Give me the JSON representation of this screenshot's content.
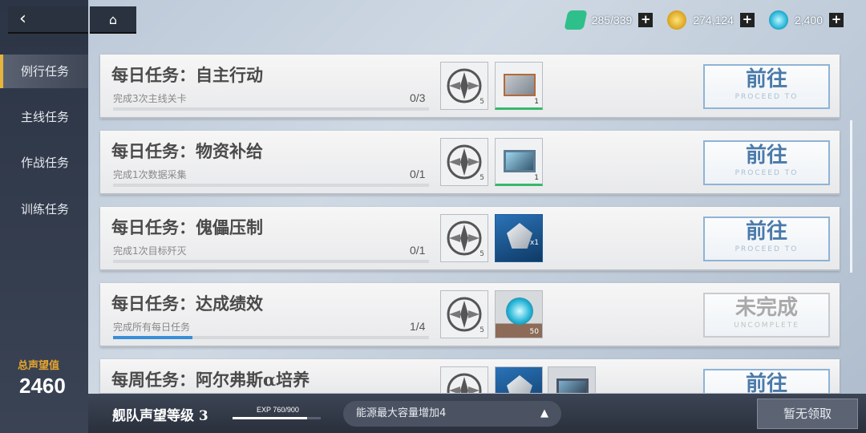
{
  "nav": {
    "back_icon": "‹",
    "home_icon": "⌂"
  },
  "sidebar": {
    "items": [
      {
        "label": "例行任务",
        "active": true
      },
      {
        "label": "主线任务",
        "active": false
      },
      {
        "label": "作战任务",
        "active": false
      },
      {
        "label": "训练任务",
        "active": false
      }
    ],
    "reputation_label": "总声望值",
    "reputation_value": "2460"
  },
  "resources": [
    {
      "icon": "stamina-battery-icon",
      "value": "285/339",
      "color": "#2fbf8a"
    },
    {
      "icon": "gold-coin-icon",
      "value": "274,124",
      "color": "#e3b52a"
    },
    {
      "icon": "crystal-core-icon",
      "value": "2,400",
      "color": "#27b6d8"
    }
  ],
  "tasks": [
    {
      "title": "每日任务：自主行动",
      "desc": "完成3次主线关卡",
      "progress": "0/3",
      "fraction": 0.0,
      "rewards": [
        {
          "kind": "badge",
          "icon": "reputation-badge-icon",
          "level": "5"
        },
        {
          "kind": "item",
          "icon": "data-chip-icon",
          "qty": "1",
          "color": "#b46a3a"
        }
      ],
      "button": {
        "main": "前往",
        "sub": "PROCEED TO",
        "state": "go"
      }
    },
    {
      "title": "每日任务：物资补给",
      "desc": "完成1次数据采集",
      "progress": "0/1",
      "fraction": 0.0,
      "rewards": [
        {
          "kind": "badge",
          "icon": "reputation-badge-icon",
          "level": "5"
        },
        {
          "kind": "item",
          "icon": "tablet-device-icon",
          "qty": "1",
          "color": "#5c7c94"
        }
      ],
      "button": {
        "main": "前往",
        "sub": "PROCEED TO",
        "state": "go"
      }
    },
    {
      "title": "每日任务：傀儡压制",
      "desc": "完成1次目标歼灭",
      "progress": "0/1",
      "fraction": 0.0,
      "rewards": [
        {
          "kind": "badge",
          "icon": "reputation-badge-icon",
          "level": "5"
        },
        {
          "kind": "item",
          "icon": "mech-unit-icon",
          "qty": "x1",
          "color": "#1d5b9a"
        }
      ],
      "button": {
        "main": "前往",
        "sub": "PROCEED TO",
        "state": "go"
      }
    },
    {
      "title": "每日任务：达成绩效",
      "desc": "完成所有每日任务",
      "progress": "1/4",
      "fraction": 0.25,
      "rewards": [
        {
          "kind": "badge",
          "icon": "reputation-badge-icon",
          "level": "5"
        },
        {
          "kind": "item",
          "icon": "crystal-core-icon",
          "qty": "50",
          "color": "#8c6c58"
        }
      ],
      "button": {
        "main": "未完成",
        "sub": "UNCOMPLETE",
        "state": "incomplete"
      }
    },
    {
      "title": "每周任务：阿尔弗斯α培养",
      "desc": "",
      "progress": "",
      "fraction": 0.0,
      "rewards": [
        {
          "kind": "badge",
          "icon": "reputation-badge-icon",
          "level": ""
        },
        {
          "kind": "item",
          "icon": "mech-unit-icon",
          "qty": "",
          "color": "#1d5b9a"
        },
        {
          "kind": "item",
          "icon": "tablet-device-icon",
          "qty": "",
          "color": "#4b5566"
        }
      ],
      "button": {
        "main": "前往",
        "sub": "",
        "state": "go"
      }
    }
  ],
  "bottom": {
    "fleet_level_label": "舰队声望等级 3",
    "exp_label": "EXP  760/900",
    "exp_fraction": 0.8444,
    "bonus_text": "能源最大容量增加4",
    "bonus_arrow": "▲",
    "claim_label": "暂无领取"
  }
}
